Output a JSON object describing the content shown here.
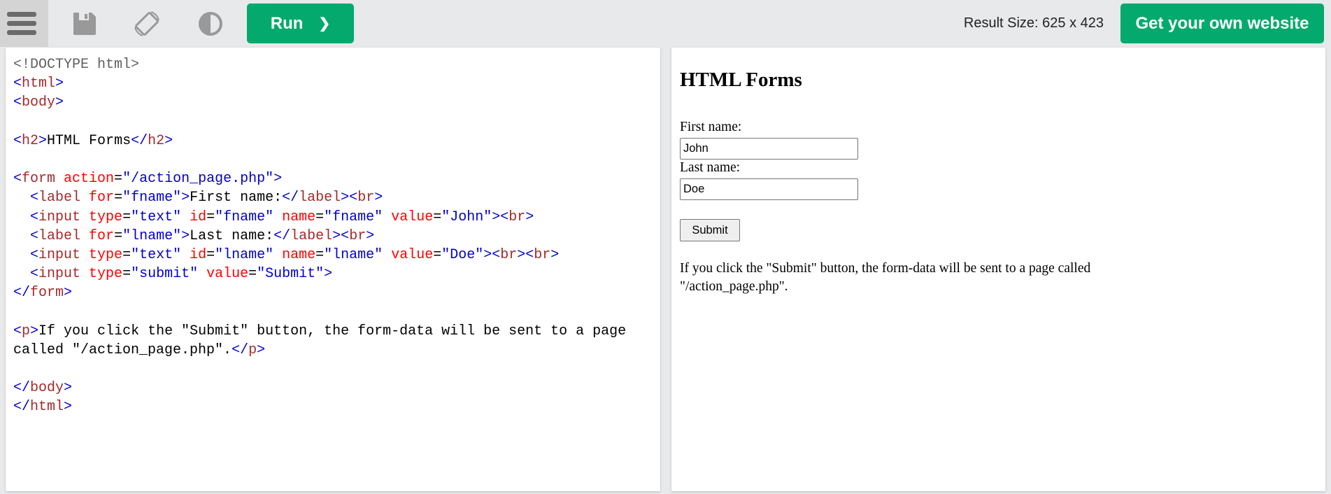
{
  "toolbar": {
    "run_label": "Run",
    "run_chevron": "❯",
    "result_size": "Result Size: 625 x 423",
    "get_website_label": "Get your own website",
    "accent": "#04aa6d"
  },
  "code_lines": [
    [
      [
        "doc",
        "<!DOCTYPE html>"
      ]
    ],
    [
      [
        "br",
        "<"
      ],
      [
        "tag",
        "html"
      ],
      [
        "br",
        ">"
      ]
    ],
    [
      [
        "br",
        "<"
      ],
      [
        "tag",
        "body"
      ],
      [
        "br",
        ">"
      ]
    ],
    [],
    [
      [
        "br",
        "<"
      ],
      [
        "tag",
        "h2"
      ],
      [
        "br",
        ">"
      ],
      [
        "txt",
        "HTML Forms"
      ],
      [
        "br",
        "</"
      ],
      [
        "tag",
        "h2"
      ],
      [
        "br",
        ">"
      ]
    ],
    [],
    [
      [
        "br",
        "<"
      ],
      [
        "tag",
        "form"
      ],
      [
        "attr",
        " action"
      ],
      [
        "txt",
        "="
      ],
      [
        "val",
        "\"/action_page.php\""
      ],
      [
        "br",
        ">"
      ]
    ],
    [
      [
        "txt",
        "  "
      ],
      [
        "br",
        "<"
      ],
      [
        "tag",
        "label"
      ],
      [
        "attr",
        " for"
      ],
      [
        "txt",
        "="
      ],
      [
        "val",
        "\"fname\""
      ],
      [
        "br",
        ">"
      ],
      [
        "txt",
        "First name:"
      ],
      [
        "br",
        "</"
      ],
      [
        "tag",
        "label"
      ],
      [
        "br",
        "><"
      ],
      [
        "tag",
        "br"
      ],
      [
        "br",
        ">"
      ]
    ],
    [
      [
        "txt",
        "  "
      ],
      [
        "br",
        "<"
      ],
      [
        "tag",
        "input"
      ],
      [
        "attr",
        " type"
      ],
      [
        "txt",
        "="
      ],
      [
        "val",
        "\"text\""
      ],
      [
        "attr",
        " id"
      ],
      [
        "txt",
        "="
      ],
      [
        "val",
        "\"fname\""
      ],
      [
        "attr",
        " name"
      ],
      [
        "txt",
        "="
      ],
      [
        "val",
        "\"fname\""
      ],
      [
        "attr",
        " value"
      ],
      [
        "txt",
        "="
      ],
      [
        "val",
        "\"John\""
      ],
      [
        "br",
        "><"
      ],
      [
        "tag",
        "br"
      ],
      [
        "br",
        ">"
      ]
    ],
    [
      [
        "txt",
        "  "
      ],
      [
        "br",
        "<"
      ],
      [
        "tag",
        "label"
      ],
      [
        "attr",
        " for"
      ],
      [
        "txt",
        "="
      ],
      [
        "val",
        "\"lname\""
      ],
      [
        "br",
        ">"
      ],
      [
        "txt",
        "Last name:"
      ],
      [
        "br",
        "</"
      ],
      [
        "tag",
        "label"
      ],
      [
        "br",
        "><"
      ],
      [
        "tag",
        "br"
      ],
      [
        "br",
        ">"
      ]
    ],
    [
      [
        "txt",
        "  "
      ],
      [
        "br",
        "<"
      ],
      [
        "tag",
        "input"
      ],
      [
        "attr",
        " type"
      ],
      [
        "txt",
        "="
      ],
      [
        "val",
        "\"text\""
      ],
      [
        "attr",
        " id"
      ],
      [
        "txt",
        "="
      ],
      [
        "val",
        "\"lname\""
      ],
      [
        "attr",
        " name"
      ],
      [
        "txt",
        "="
      ],
      [
        "val",
        "\"lname\""
      ],
      [
        "attr",
        " value"
      ],
      [
        "txt",
        "="
      ],
      [
        "val",
        "\"Doe\""
      ],
      [
        "br",
        "><"
      ],
      [
        "tag",
        "br"
      ],
      [
        "br",
        "><"
      ],
      [
        "tag",
        "br"
      ],
      [
        "br",
        ">"
      ]
    ],
    [
      [
        "txt",
        "  "
      ],
      [
        "br",
        "<"
      ],
      [
        "tag",
        "input"
      ],
      [
        "attr",
        " type"
      ],
      [
        "txt",
        "="
      ],
      [
        "val",
        "\"submit\""
      ],
      [
        "attr",
        " value"
      ],
      [
        "txt",
        "="
      ],
      [
        "val",
        "\"Submit\""
      ],
      [
        "br",
        ">"
      ]
    ],
    [
      [
        "br",
        "</"
      ],
      [
        "tag",
        "form"
      ],
      [
        "br",
        ">"
      ]
    ],
    [],
    [
      [
        "br",
        "<"
      ],
      [
        "tag",
        "p"
      ],
      [
        "br",
        ">"
      ],
      [
        "txt",
        "If you click the \"Submit\" button, the form-data will be sent to a page"
      ]
    ],
    [
      [
        "txt",
        "called \"/action_page.php\"."
      ],
      [
        "br",
        "</"
      ],
      [
        "tag",
        "p"
      ],
      [
        "br",
        ">"
      ]
    ],
    [],
    [
      [
        "br",
        "</"
      ],
      [
        "tag",
        "body"
      ],
      [
        "br",
        ">"
      ]
    ],
    [
      [
        "br",
        "</"
      ],
      [
        "tag",
        "html"
      ],
      [
        "br",
        ">"
      ]
    ]
  ],
  "result": {
    "heading": "HTML Forms",
    "first_label": "First name:",
    "first_value": "John",
    "last_label": "Last name:",
    "last_value": "Doe",
    "submit_label": "Submit",
    "paragraph_line1": "If you click the \"Submit\" button, the form-data will be sent to a page called",
    "paragraph_line2": "\"/action_page.php\"."
  }
}
